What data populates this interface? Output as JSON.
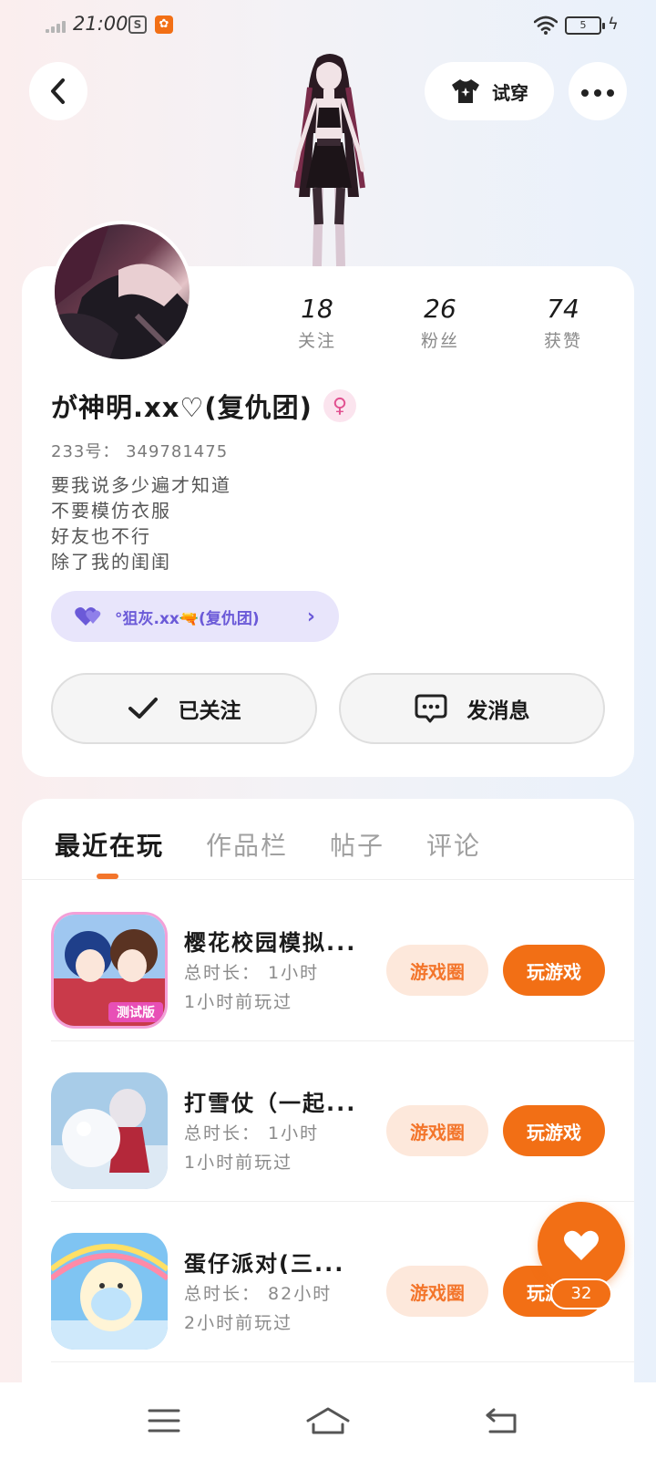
{
  "status_bar": {
    "time": "21:00",
    "battery": "5"
  },
  "header": {
    "tryon_label": "试穿"
  },
  "profile": {
    "stats": [
      {
        "value": "18",
        "label": "关注"
      },
      {
        "value": "26",
        "label": "粉丝"
      },
      {
        "value": "74",
        "label": "获赞"
      }
    ],
    "username": "が神明.xx♡(复仇团)",
    "gender_symbol": "♀",
    "uid": "233号： 349781475",
    "bio": [
      "要我说多少遍才知道",
      "不要模仿衣服",
      "好友也不行",
      "除了我的闺闺"
    ],
    "group": {
      "name": "°狙灰.xx🔫(复仇团)"
    },
    "follow_label": "已关注",
    "message_label": "发消息"
  },
  "tabs": [
    "最近在玩",
    "作品栏",
    "帖子",
    "评论"
  ],
  "games": [
    {
      "name": "樱花校园模拟...",
      "duration": "总时长： 1小时",
      "last_played": "1小时前玩过",
      "circle_label": "游戏圈",
      "play_label": "玩游戏"
    },
    {
      "name": "打雪仗（一起...",
      "duration": "总时长： 1小时",
      "last_played": "1小时前玩过",
      "circle_label": "游戏圈",
      "play_label": "玩游戏"
    },
    {
      "name": "蛋仔派对(三...",
      "duration": "总时长： 82小时",
      "last_played": "2小时前玩过",
      "circle_label": "游戏圈",
      "play_label": "玩游戏"
    }
  ],
  "like": {
    "count": "32"
  },
  "colors": {
    "accent": "#f26f15",
    "accent_light": "#fde8db",
    "group_chip_bg": "#e8e5fb",
    "group_chip_text": "#6b5ad8"
  },
  "icons": {
    "back": "chevron-left-icon",
    "tryon": "tshirt-icon",
    "more": "more-dots-icon",
    "follow_check": "check-icon",
    "message": "chat-bubble-icon",
    "like": "heart-icon",
    "nav": [
      "menu-icon",
      "home-icon",
      "back-arrow-icon"
    ]
  }
}
